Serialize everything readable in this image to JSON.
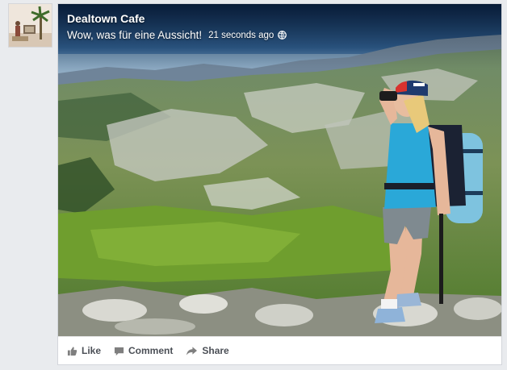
{
  "post": {
    "page_name": "Dealtown Cafe",
    "text": "Wow, was für eine Aussicht!",
    "timestamp": "21 seconds ago",
    "privacy_icon": "globe-icon"
  },
  "actions": {
    "like": "Like",
    "comment": "Comment",
    "share": "Share"
  },
  "icons": {
    "like": "thumbs-up-icon",
    "comment": "speech-bubble-icon",
    "share": "share-arrow-icon"
  },
  "colors": {
    "action_text": "#4b4f56",
    "background": "#e9ebee",
    "card_border": "#d3d6db"
  }
}
